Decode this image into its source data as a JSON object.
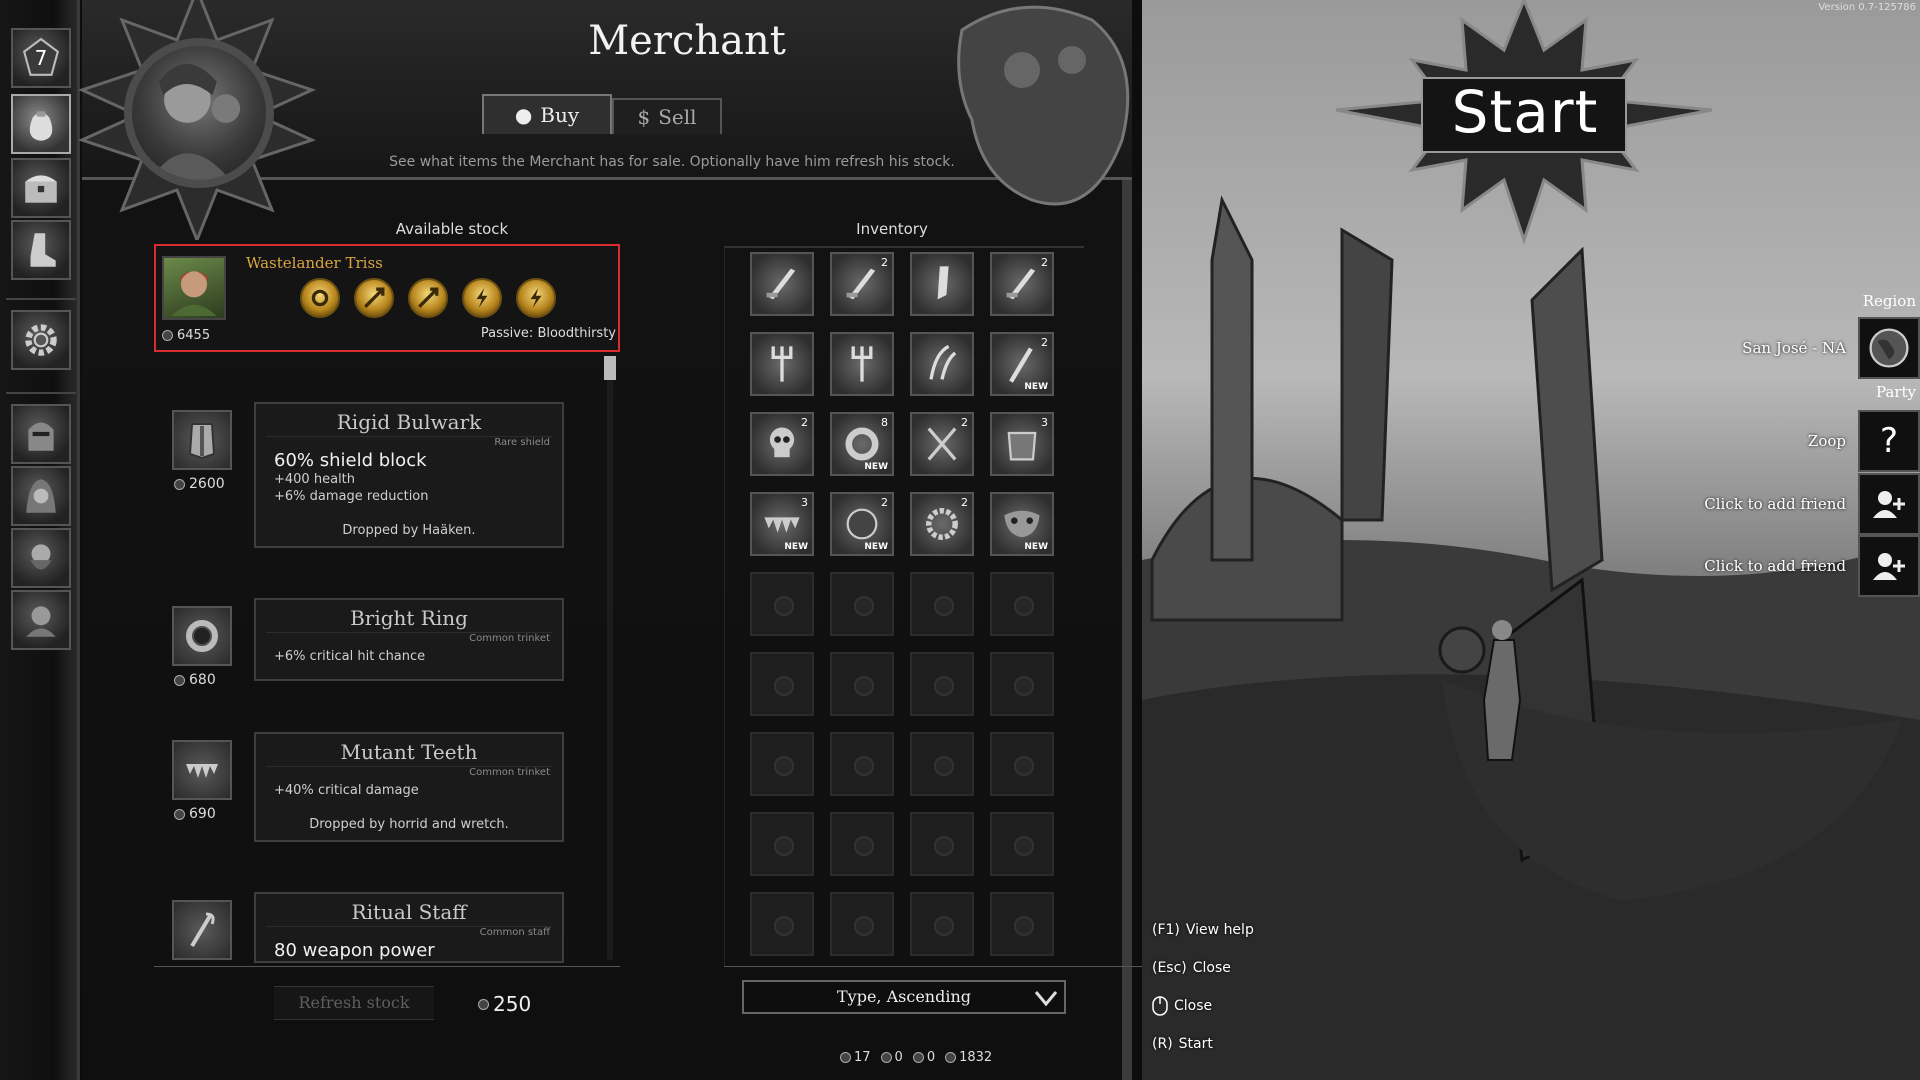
{
  "sidebar": {
    "level": "7",
    "buttons": [
      {
        "name": "level-icon"
      },
      {
        "name": "merchant-bag-icon"
      },
      {
        "name": "chest-icon"
      },
      {
        "name": "boot-icon"
      },
      {
        "name": "gear-icon"
      },
      {
        "name": "hero-portrait-1"
      },
      {
        "name": "hero-portrait-2"
      },
      {
        "name": "hero-portrait-3"
      },
      {
        "name": "hero-portrait-4"
      }
    ]
  },
  "merchant": {
    "title": "Merchant",
    "tabs": [
      {
        "label": "Buy",
        "active": true
      },
      {
        "label": "Sell",
        "active": false
      }
    ],
    "subtitle": "See what items the Merchant has for sale. Optionally have him refresh his stock."
  },
  "stock": {
    "title": "Available stock",
    "hero": {
      "name": "Wastelander Triss",
      "gold": "6455",
      "passive_label": "Passive:",
      "passive": "Bloodthirsty",
      "skills": [
        "spin-skill-icon",
        "arrow-skill-icon",
        "arrow-skill-icon",
        "lightning-skill-icon",
        "lightning-skill-icon"
      ]
    },
    "items": [
      {
        "name": "Rigid Bulwark",
        "rarity": "Rare shield",
        "price": "2600",
        "main_value": "60%",
        "main_text": "shield block",
        "stats": [
          {
            "value": "+400",
            "text": "health"
          },
          {
            "value": "+6%",
            "text": "damage reduction"
          }
        ],
        "drop": "Dropped by Haäken.",
        "icon": "shield-icon"
      },
      {
        "name": "Bright Ring",
        "rarity": "Common trinket",
        "price": "680",
        "main_value": "",
        "main_text": "",
        "stats": [
          {
            "value": "+6%",
            "text": "critical hit chance"
          }
        ],
        "drop": "",
        "icon": "ring-icon"
      },
      {
        "name": "Mutant Teeth",
        "rarity": "Common trinket",
        "price": "690",
        "main_value": "",
        "main_text": "",
        "stats": [
          {
            "value": "+40%",
            "text": "critical damage"
          }
        ],
        "drop": "Dropped by horrid and wretch.",
        "icon": "teeth-icon"
      },
      {
        "name": "Ritual Staff",
        "rarity": "Common staff",
        "price": "",
        "main_value": "80",
        "main_text": "weapon power",
        "stats": [],
        "drop": "",
        "icon": "staff-icon"
      }
    ],
    "refresh_label": "Refresh stock",
    "refresh_cost": "250"
  },
  "inventory": {
    "title": "Inventory",
    "slots": [
      {
        "icon": "sword-icon",
        "count": "",
        "new": false
      },
      {
        "icon": "sword-icon",
        "count": "2",
        "new": false
      },
      {
        "icon": "blade-icon",
        "count": "",
        "new": false
      },
      {
        "icon": "sword-icon",
        "count": "2",
        "new": false
      },
      {
        "icon": "trident-icon",
        "count": "",
        "new": false
      },
      {
        "icon": "trident-icon",
        "count": "",
        "new": false
      },
      {
        "icon": "claw-icon",
        "count": "",
        "new": false
      },
      {
        "icon": "staff-icon",
        "count": "2",
        "new": true
      },
      {
        "icon": "skull-icon",
        "count": "2",
        "new": false
      },
      {
        "icon": "ring-icon",
        "count": "8",
        "new": true
      },
      {
        "icon": "amulet-icon",
        "count": "2",
        "new": false
      },
      {
        "icon": "armor-icon",
        "count": "3",
        "new": false
      },
      {
        "icon": "teeth-icon",
        "count": "3",
        "new": true
      },
      {
        "icon": "orb-icon",
        "count": "2",
        "new": true
      },
      {
        "icon": "gear-ring-icon",
        "count": "2",
        "new": false
      },
      {
        "icon": "mask-icon",
        "count": "",
        "new": true
      }
    ],
    "empty_slots": 20,
    "new_label": "NEW",
    "sort": "Type, Ascending"
  },
  "currency": [
    "17",
    "0",
    "0",
    "1832"
  ],
  "scene": {
    "version": "Version 0.7-125786",
    "start_label": "Start",
    "region_label": "Region",
    "region": "San José - NA",
    "party_label": "Party",
    "party": [
      {
        "name": "Zoop",
        "icon": "question-icon",
        "glyph": "?"
      },
      {
        "name": "Click to add friend",
        "icon": "add-friend-icon",
        "glyph": ""
      },
      {
        "name": "Click to add friend",
        "icon": "add-friend-icon",
        "glyph": ""
      }
    ],
    "hotkeys": [
      {
        "key": "(F1)",
        "label": "View help"
      },
      {
        "key": "(Esc)",
        "label": "Close"
      },
      {
        "key": "",
        "label": "Close",
        "mouse": true
      },
      {
        "key": "(R)",
        "label": "Start"
      }
    ]
  }
}
